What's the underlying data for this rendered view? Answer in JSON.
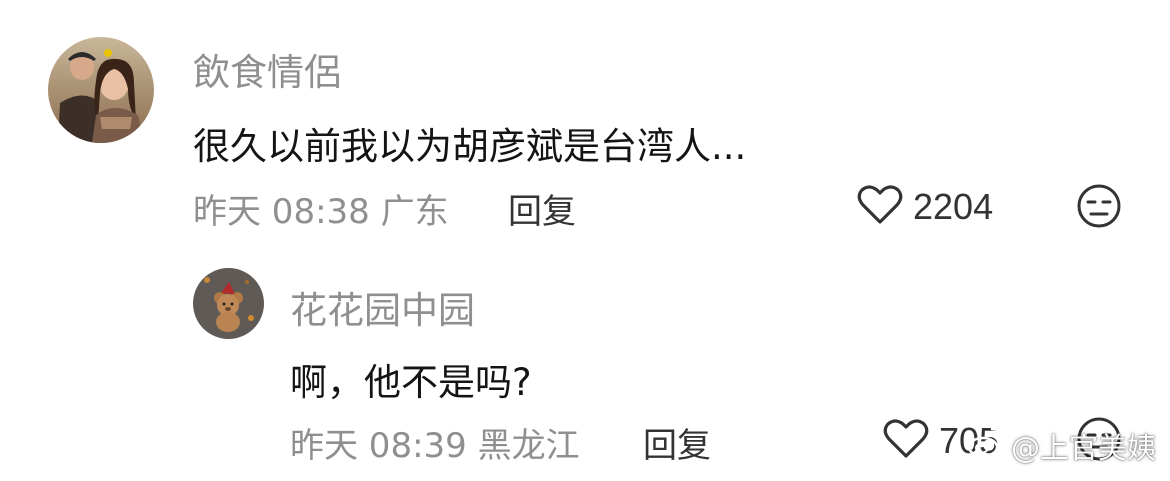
{
  "comments": [
    {
      "username": "飲食情侶",
      "text": "很久以前我以为胡彦斌是台湾人...",
      "time": "昨天 08:38",
      "location": "广东",
      "reply_label": "回复",
      "likes": "2204"
    }
  ],
  "replies": [
    {
      "username": "花花园中园",
      "text": "啊，他不是吗?",
      "time": "昨天 08:39",
      "location": "黑龙江",
      "reply_label": "回复",
      "likes": "705"
    }
  ],
  "watermark": {
    "text": "@上官美姨"
  },
  "colors": {
    "meta_gray": "#8f8f8f",
    "text_dark": "#141414"
  },
  "icons": [
    "heart-icon",
    "dislike-face-icon",
    "weibo-logo-icon"
  ]
}
